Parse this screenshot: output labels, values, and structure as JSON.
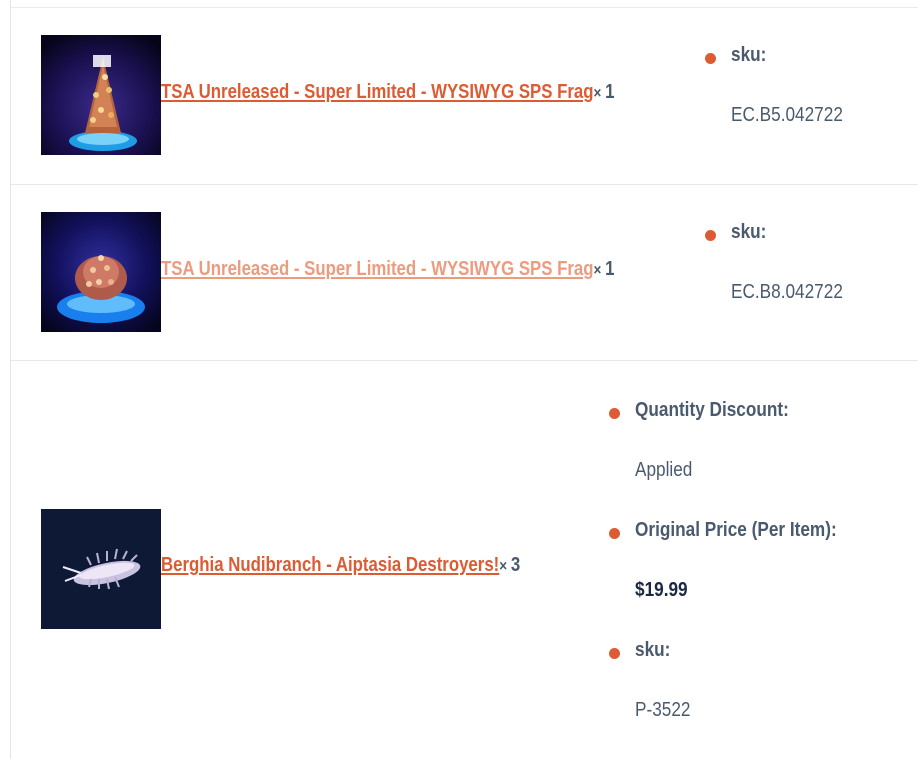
{
  "items": [
    {
      "title": "TSA Unreleased - Super Limited - WYSIWYG SPS Frag",
      "qty_mark": "×",
      "qty": "1",
      "meta": [
        {
          "key": "sku:",
          "value": "EC.B5.042722"
        }
      ]
    },
    {
      "title": "TSA Unreleased - Super Limited - WYSIWYG SPS Frag",
      "qty_mark": "×",
      "qty": "1",
      "meta": [
        {
          "key": "sku:",
          "value": "EC.B8.042722"
        }
      ]
    },
    {
      "title": "Berghia Nudibranch - Aiptasia Destroyers!",
      "qty_mark": "×",
      "qty": "3",
      "meta": [
        {
          "key": "Quantity Discount:",
          "value": "Applied"
        },
        {
          "key": "Original Price (Per Item):",
          "value": "$19.99"
        },
        {
          "key": "sku:",
          "value": "P-3522"
        }
      ]
    }
  ],
  "colors": {
    "link": "#dd5b32",
    "link_visited": "#ee9a7f",
    "text": "#4a5a6e",
    "price": "#1a2a40",
    "bullet": "#dd5b32"
  },
  "icons": {
    "bullet": "filled-circle"
  }
}
